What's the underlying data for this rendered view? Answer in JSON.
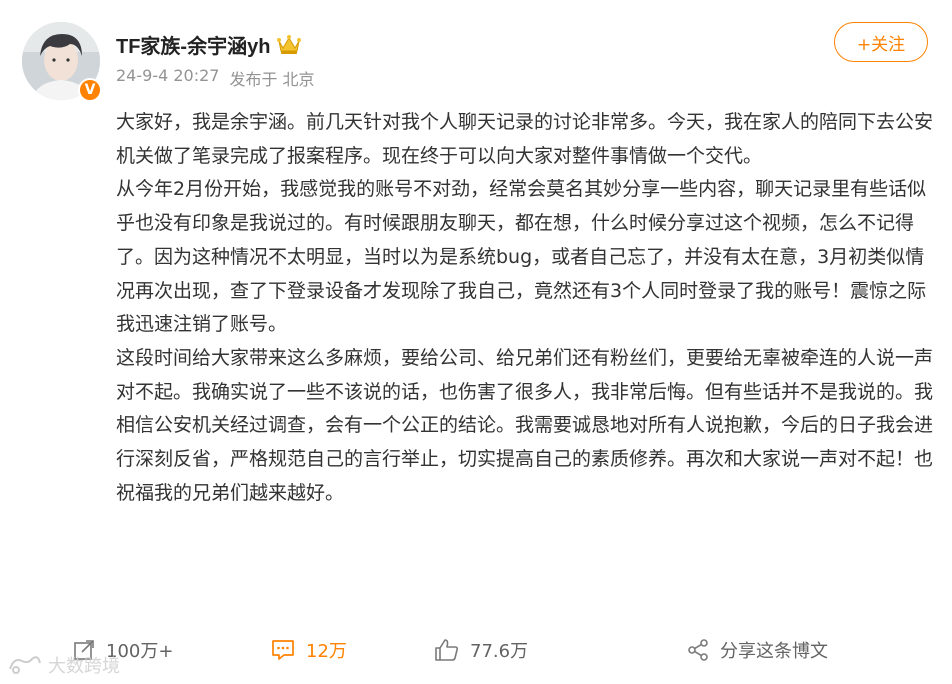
{
  "author": {
    "name": "TF家族-余宇涵yh",
    "verified_badge": "V"
  },
  "meta": {
    "date": "24-9-4 20:27",
    "location": "发布于 北京"
  },
  "follow_label": "+关注",
  "post": {
    "paragraphs": [
      "大家好，我是余宇涵。前几天针对我个人聊天记录的讨论非常多。今天，我在家人的陪同下去公安机关做了笔录完成了报案程序。现在终于可以向大家对整件事情做一个交代。",
      "从今年2月份开始，我感觉我的账号不对劲，经常会莫名其妙分享一些内容，聊天记录里有些话似乎也没有印象是我说过的。有时候跟朋友聊天，都在想，什么时候分享过这个视频，怎么不记得了。因为这种情况不太明显，当时以为是系统bug，或者自己忘了，并没有太在意，3月初类似情况再次出现，查了下登录设备才发现除了我自己，竟然还有3个人同时登录了我的账号！震惊之际我迅速注销了账号。",
      "这段时间给大家带来这么多麻烦，要给公司、给兄弟们还有粉丝们，更要给无辜被牵连的人说一声对不起。我确实说了一些不该说的话，也伤害了很多人，我非常后悔。但有些话并不是我说的。我相信公安机关经过调查，会有一个公正的结论。我需要诚恳地对所有人说抱歉，今后的日子我会进行深刻反省，严格规范自己的言行举止，切实提高自己的素质修养。再次和大家说一声对不起！也祝福我的兄弟们越来越好。"
    ]
  },
  "actions": {
    "repost": "100万+",
    "comment": "12万",
    "like": "77.6万",
    "share": "分享这条博文"
  },
  "watermark": "大数跨境",
  "colors": {
    "accent": "#ff8200",
    "text": "#333333",
    "muted": "#939393"
  }
}
